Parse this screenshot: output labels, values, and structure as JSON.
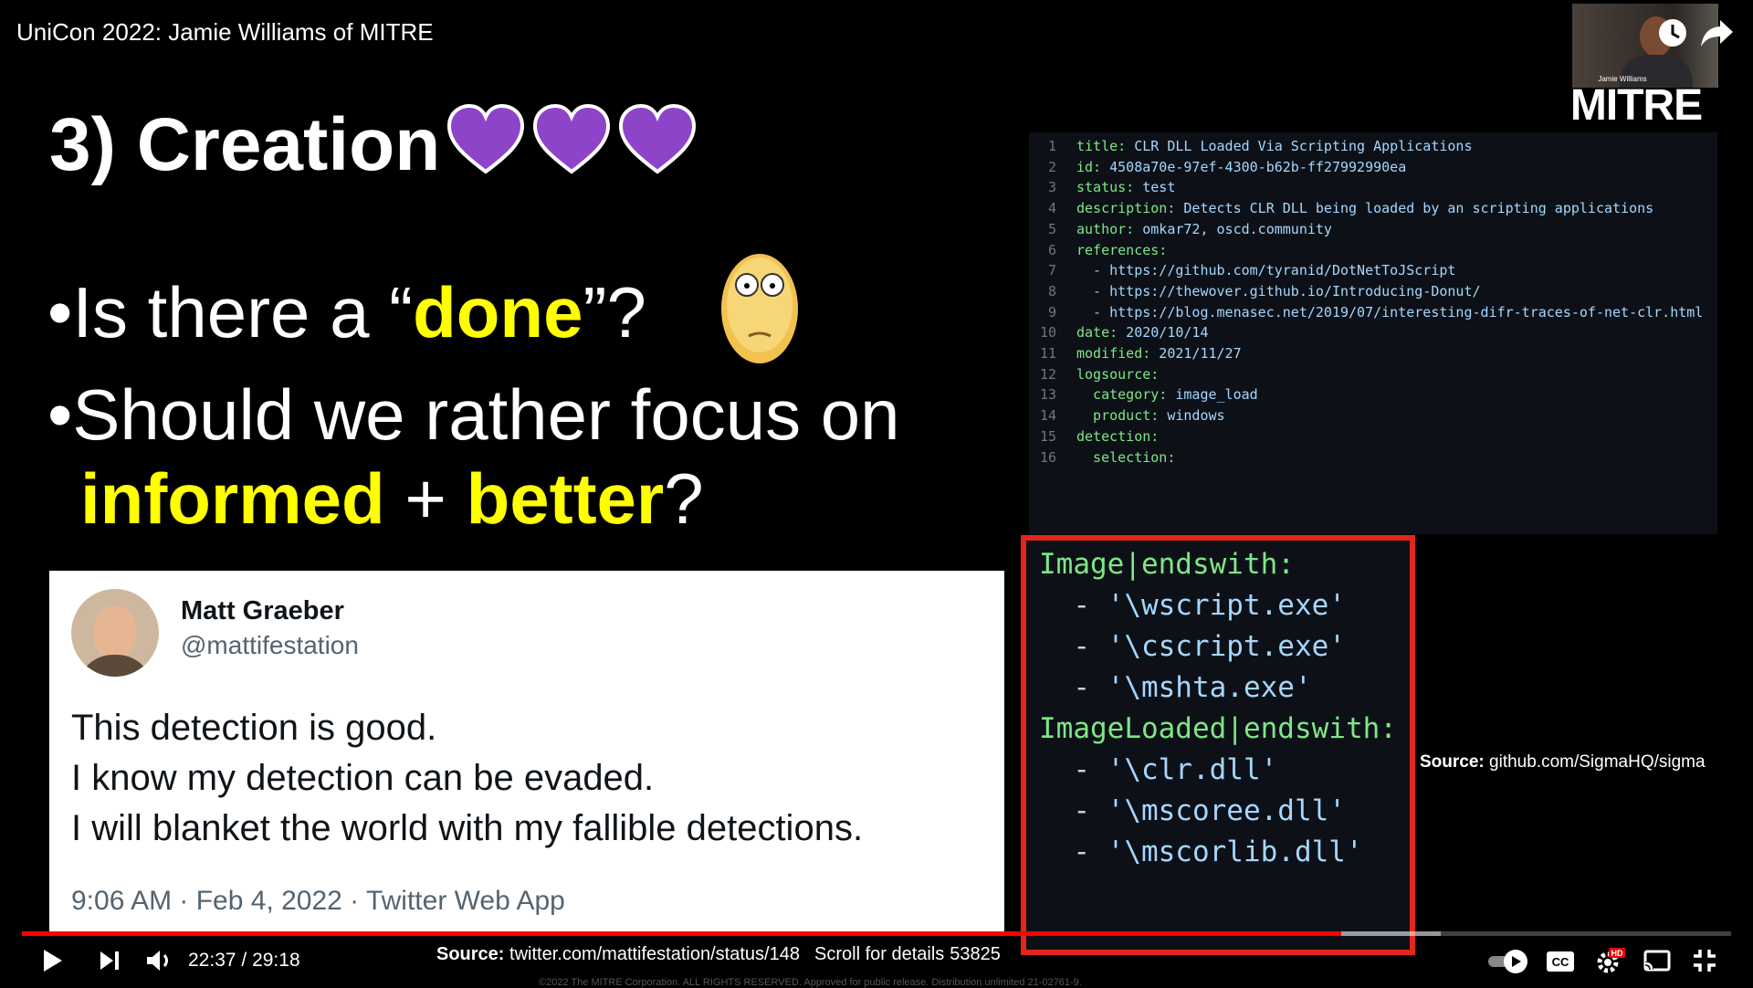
{
  "video": {
    "title": "UniCon 2022: Jamie Williams of MITRE",
    "presenter_name": "Jamie Williams",
    "logo_text": "MITRE"
  },
  "slide": {
    "heading": "3) Creation",
    "heart_color": "#8e44c8",
    "bullet1": {
      "prefix": "Is there a “",
      "highlight": "done",
      "suffix": "”?"
    },
    "bullet2": {
      "line1": "Should we rather focus on",
      "highlight1": "informed",
      "middle": " + ",
      "highlight2": "better",
      "suffix": "?"
    },
    "highlight_color": "#ffff00"
  },
  "tweet": {
    "name": "Matt Graeber",
    "handle": "@mattifestation",
    "line1": "This detection is good.",
    "line2": "I know my detection can be evaded.",
    "line3": "I will blanket the world with my fallible detections.",
    "meta": "9:06 AM · Feb 4, 2022 · Twitter Web App"
  },
  "code": {
    "lines": [
      {
        "n": "1",
        "key": "title:",
        "val": " CLR DLL Loaded Via Scripting Applications"
      },
      {
        "n": "2",
        "key": "id:",
        "val": " 4508a70e-97ef-4300-b62b-ff27992990ea"
      },
      {
        "n": "3",
        "key": "status:",
        "val": " test"
      },
      {
        "n": "4",
        "key": "description:",
        "val": " Detects CLR DLL being loaded by an scripting applications"
      },
      {
        "n": "5",
        "key": "author:",
        "val": " omkar72, oscd.community"
      },
      {
        "n": "6",
        "key": "references:",
        "val": ""
      },
      {
        "n": "7",
        "key": "  - ",
        "val": "https://github.com/tyranid/DotNetToJScript"
      },
      {
        "n": "8",
        "key": "  - ",
        "val": "https://thewover.github.io/Introducing-Donut/"
      },
      {
        "n": "9",
        "key": "  - ",
        "val": "https://blog.menasec.net/2019/07/interesting-difr-traces-of-net-clr.html"
      },
      {
        "n": "10",
        "key": "date:",
        "val": " 2020/10/14"
      },
      {
        "n": "11",
        "key": "modified:",
        "val": " 2021/11/27"
      },
      {
        "n": "12",
        "key": "logsource:",
        "val": ""
      },
      {
        "n": "13",
        "key": "  category:",
        "val": " image_load"
      },
      {
        "n": "14",
        "key": "  product:",
        "val": " windows"
      },
      {
        "n": "15",
        "key": "detection:",
        "val": ""
      },
      {
        "n": "16",
        "key": "  selection:",
        "val": ""
      }
    ],
    "source_label": "Source:",
    "source_value": "github.com/SigmaHQ/sigma",
    "highlight_border_color": "#e3261c"
  },
  "zoom": {
    "lines": [
      {
        "dash": "",
        "key": "Image|endswith:",
        "val": ""
      },
      {
        "dash": "  - ",
        "key": "",
        "val": "'\\wscript.exe'"
      },
      {
        "dash": "  - ",
        "key": "",
        "val": "'\\cscript.exe'"
      },
      {
        "dash": "  - ",
        "key": "",
        "val": "'\\mshta.exe'"
      },
      {
        "dash": "",
        "key": "ImageLoaded|endswith:",
        "val": ""
      },
      {
        "dash": "  - ",
        "key": "",
        "val": "'\\clr.dll'"
      },
      {
        "dash": "  - ",
        "key": "",
        "val": "'\\mscoree.dll'"
      },
      {
        "dash": "  - ",
        "key": "",
        "val": "'\\mscorlib.dll'"
      }
    ]
  },
  "credits": {
    "twitter_label": "Source:",
    "twitter_value": "twitter.com/mattifestation/status/148",
    "twitter_tail": "53825",
    "scroll_hint": "Scroll for details",
    "copyright": "©2022 The MITRE Corporation. ALL RIGHTS RESERVED. Approved for public release. Distribution unlimited 21-02761-9."
  },
  "player": {
    "current_time": "22:37",
    "duration": "29:18",
    "time_separator": " / ",
    "played_fraction": 0.772,
    "buffered_fraction": 0.83,
    "quality_badge": "HD",
    "accent_color": "#ff0000"
  }
}
